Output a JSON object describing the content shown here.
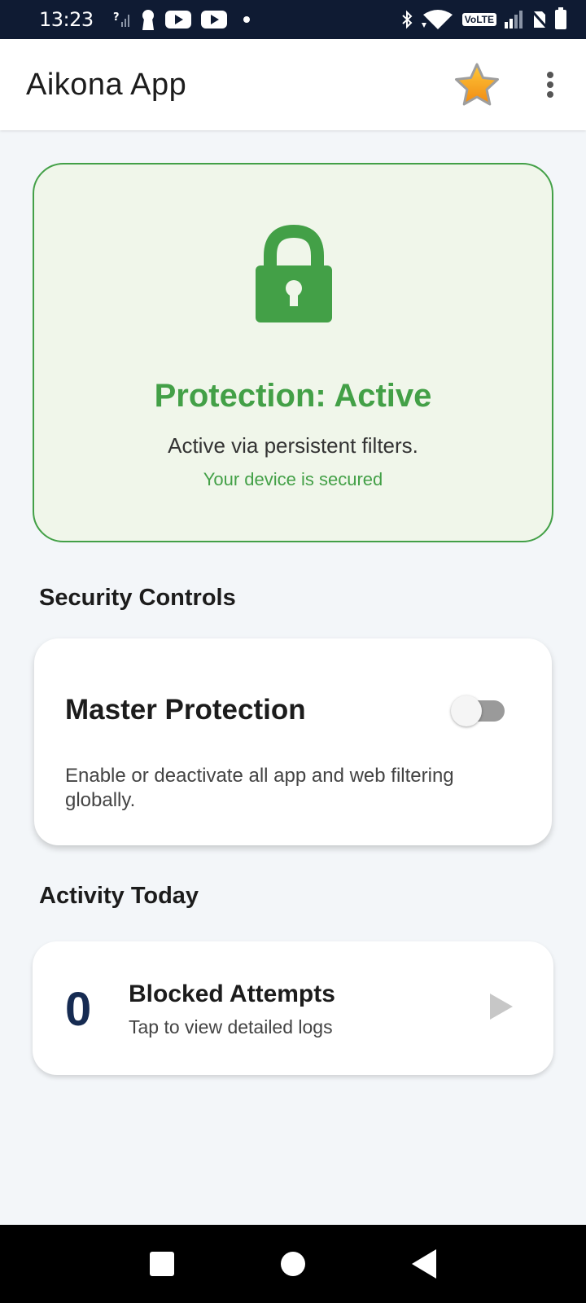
{
  "status_bar": {
    "time": "13:23",
    "volte": "VoLTE"
  },
  "app_bar": {
    "title": "Aikona App"
  },
  "protection": {
    "title": "Protection: Active",
    "subtitle": "Active via persistent filters.",
    "note": "Your device is secured",
    "color": "#43a047"
  },
  "security_controls": {
    "section_title": "Security Controls",
    "master": {
      "title": "Master Protection",
      "description": "Enable or deactivate all app and web filtering globally.",
      "enabled": false
    }
  },
  "activity": {
    "section_title": "Activity Today",
    "blocked_count": "0",
    "title": "Blocked Attempts",
    "subtitle": "Tap to view detailed logs"
  }
}
